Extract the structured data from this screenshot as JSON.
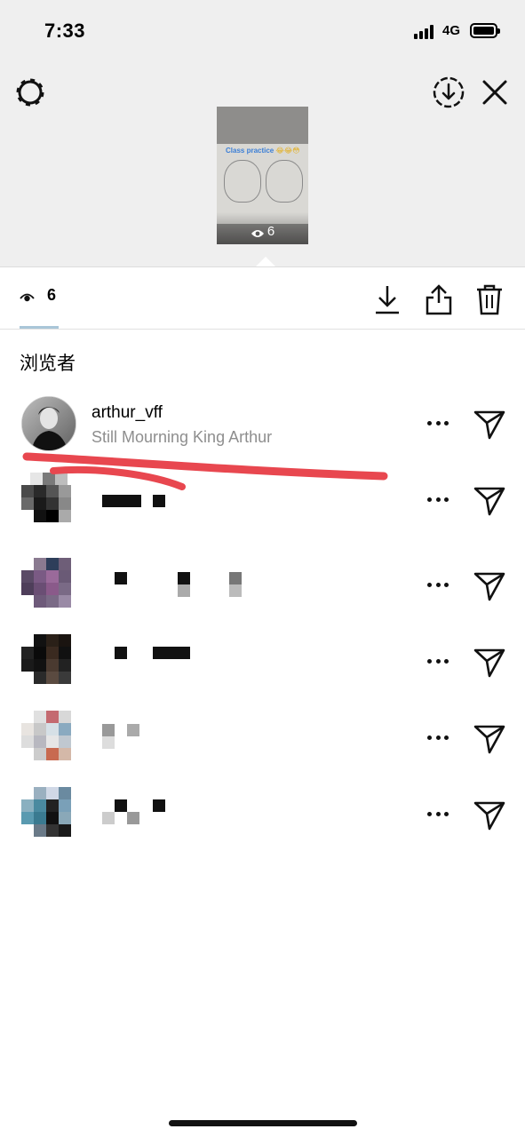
{
  "status_bar": {
    "time": "7:33",
    "network": "4G",
    "battery_level": 1.0
  },
  "header": {
    "settings_icon": "gear-icon",
    "save_icon": "download-circle-icon",
    "close_icon": "close-icon"
  },
  "story_thumbnail": {
    "caption": "Class practice",
    "emoji": "😂😂😳",
    "view_count": "6"
  },
  "viewers_tab": {
    "view_count": "6",
    "eye_icon": "eye-icon"
  },
  "actions": {
    "download": "download-icon",
    "share": "share-icon",
    "delete": "trash-icon"
  },
  "section_title": "浏览者",
  "viewers": [
    {
      "username": "arthur_vff",
      "subtitle": "Still Mourning King Arthur",
      "redacted": false
    },
    {
      "username": "",
      "subtitle": "",
      "redacted": true
    },
    {
      "username": "",
      "subtitle": "",
      "redacted": true
    },
    {
      "username": "",
      "subtitle": "",
      "redacted": true
    },
    {
      "username": "",
      "subtitle": "",
      "redacted": true
    },
    {
      "username": "",
      "subtitle": "",
      "redacted": true
    }
  ],
  "colors": {
    "background": "#ffffff",
    "top_area": "#efefef",
    "annotation_red": "#e8474f",
    "muted_text": "#8e8e8e"
  }
}
